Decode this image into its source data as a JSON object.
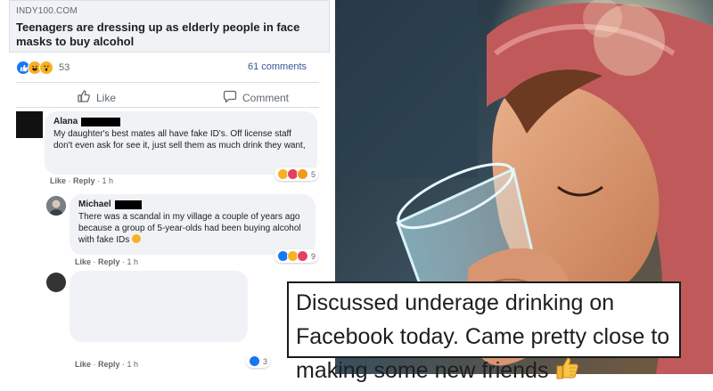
{
  "post": {
    "domain": "INDY100.COM",
    "headline": "Teenagers are dressing up as elderly people in face masks to buy alcohol",
    "reaction_count": "53",
    "comments_label": "61 comments",
    "like_label": "Like",
    "comment_label": "Comment"
  },
  "comments": [
    {
      "name": "Alana",
      "text": "My daughter's best mates all have fake ID's. Off license staff don't even ask for see it, just sell them as much drink they want,",
      "like_label": "Like",
      "reply_label": "Reply",
      "time": "1 h",
      "reaction_count": "5"
    },
    {
      "name": "Michael",
      "text": "There was a scandal in my village a couple of years ago because a group of 5-year-olds had been buying alcohol with fake IDs",
      "like_label": "Like",
      "reply_label": "Reply",
      "time": "1 h",
      "reaction_count": "9"
    },
    {
      "like_label": "Like",
      "reply_label": "Reply",
      "time": "1 h",
      "reaction_count": "3"
    }
  ],
  "caption": {
    "text": "Discussed underage drinking on Facebook today. Came pretty close to making some new friends"
  },
  "colors": {
    "fb_blue": "#1877f2",
    "link_blue": "#385898",
    "reaction_yellow": "#f7b125",
    "reaction_red": "#e4405f"
  }
}
